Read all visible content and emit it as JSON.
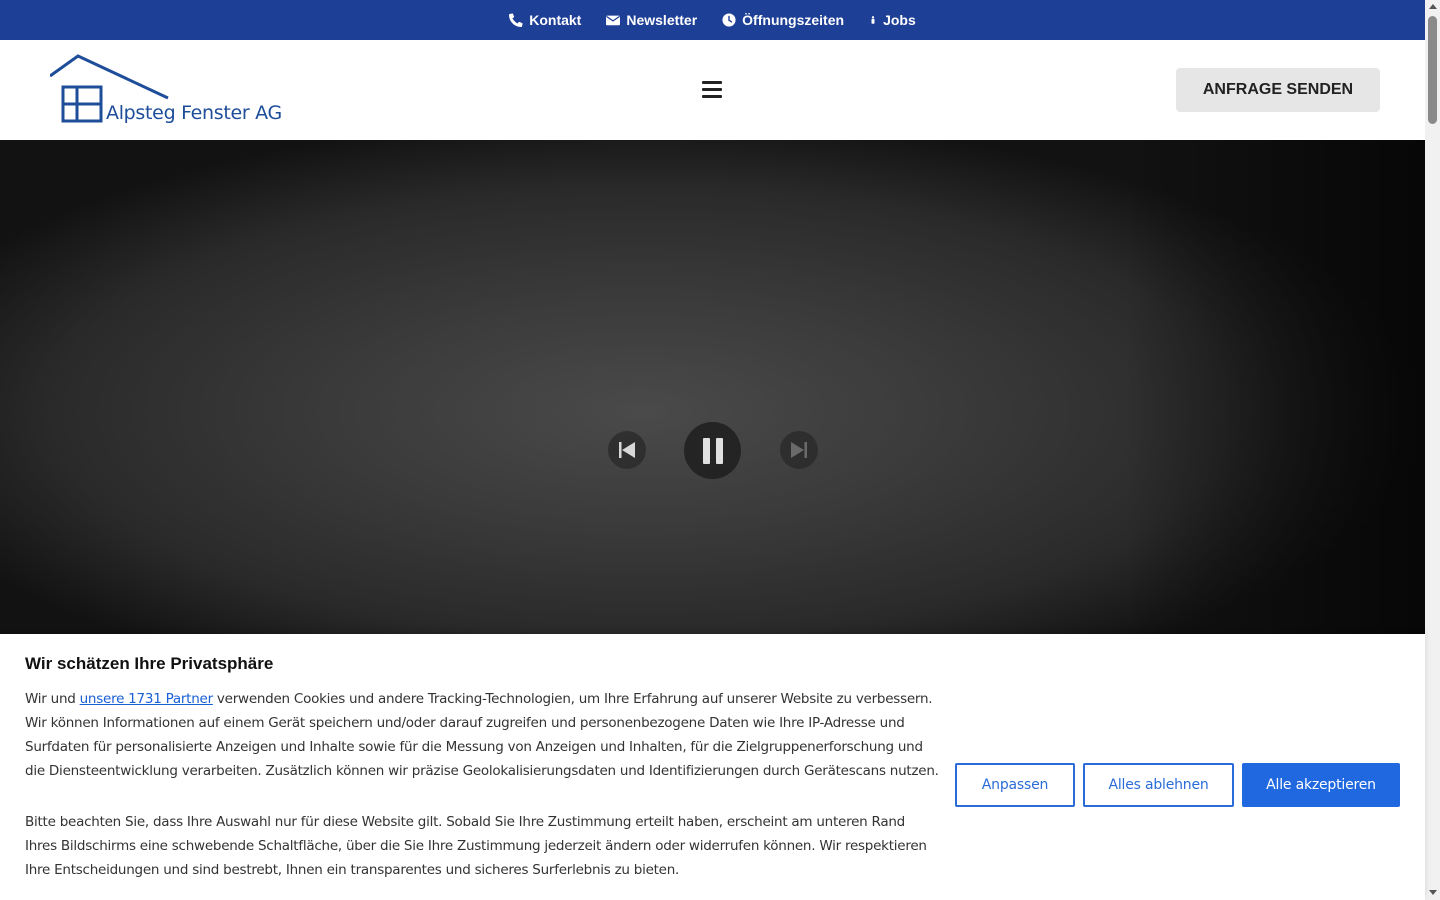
{
  "topbar": {
    "links": [
      {
        "label": "Kontakt",
        "icon": "phone-icon"
      },
      {
        "label": "Newsletter",
        "icon": "envelope-icon"
      },
      {
        "label": "Öffnungszeiten",
        "icon": "clock-icon"
      },
      {
        "label": "Jobs",
        "icon": "person-icon"
      }
    ],
    "background": "#1e3f96"
  },
  "header": {
    "logo_text": "Alpsteg Fenster AG",
    "logo_color": "#1e4d9a",
    "menu_icon": "hamburger-icon",
    "cta_label": "ANFRAGE SENDEN"
  },
  "hero": {
    "controls": {
      "prev_icon": "skip-previous-icon",
      "pause_icon": "pause-icon",
      "next_icon": "skip-next-icon"
    }
  },
  "cookie": {
    "title": "Wir schätzen Ihre Privatsphäre",
    "p1_before": "Wir und ",
    "p1_link": "unsere 1731 Partner",
    "p1_after": " verwenden Cookies und andere Tracking-Technologien, um Ihre Erfahrung auf unserer Website zu verbessern. Wir können Informationen auf einem Gerät speichern und/oder darauf zugreifen und personenbezogene Daten wie Ihre IP-Adresse und Surfdaten für personalisierte Anzeigen und Inhalte sowie für die Messung von Anzeigen und Inhalten, für die Zielgruppenerforschung und die Diensteentwicklung verarbeiten. Zusätzlich können wir präzise Geolokalisierungsdaten und Identifizierungen durch Gerätescans nutzen.",
    "p2": "Bitte beachten Sie, dass Ihre Auswahl nur für diese Website gilt. Sobald Sie Ihre Zustimmung erteilt haben, erscheint am unteren Rand Ihres Bildschirms eine schwebende Schaltfläche, über die Sie Ihre Zustimmung jederzeit ändern oder widerrufen können. Wir respektieren Ihre Entscheidungen und sind bestrebt, Ihnen ein transparentes und sicheres Surferlebnis zu bieten.",
    "buttons": {
      "customize": "Anpassen",
      "reject": "Alles ablehnen",
      "accept": "Alle akzeptieren"
    },
    "accent": "#1f68e0"
  }
}
